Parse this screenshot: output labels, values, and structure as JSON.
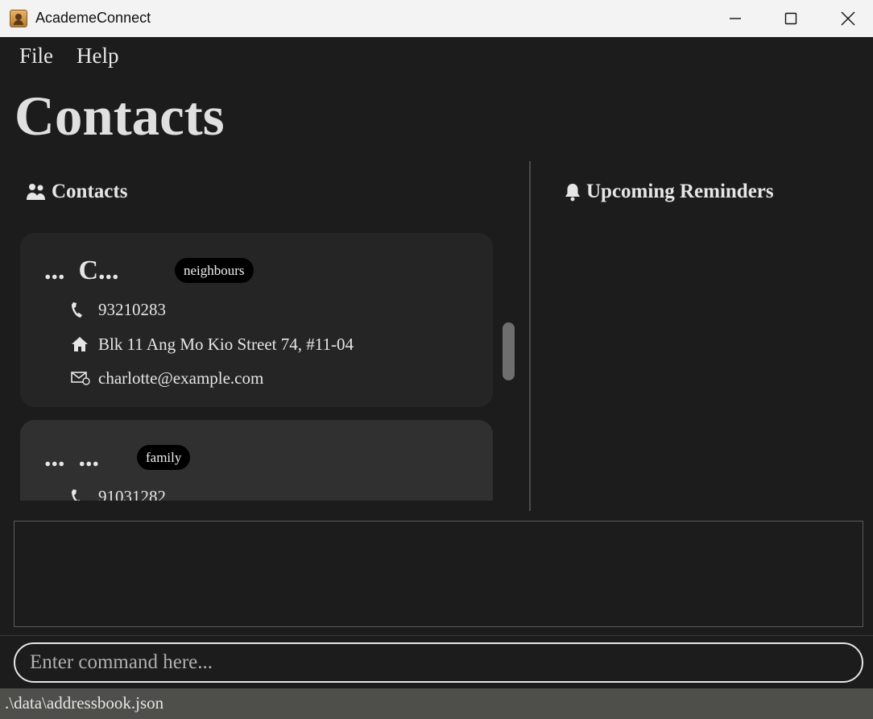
{
  "window": {
    "title": "AcademeConnect"
  },
  "menu": {
    "file": "File",
    "help": "Help"
  },
  "page_title": "Contacts",
  "contacts_panel": {
    "header": "Contacts"
  },
  "reminders_panel": {
    "header": "Upcoming Reminders"
  },
  "contacts": [
    {
      "name": "...  C...",
      "tag": "neighbours",
      "phone": "93210283",
      "address": "Blk 11 Ang Mo Kio Street 74, #11-04",
      "email": "charlotte@example.com"
    },
    {
      "name": "...  ...",
      "tag": "family",
      "phone": "91031282"
    }
  ],
  "command": {
    "placeholder": "Enter command here..."
  },
  "status": {
    "path": ".\\data\\addressbook.json"
  },
  "icons": {
    "app": "address-book-icon",
    "contacts": "people-icon",
    "reminders": "bell-icon",
    "phone": "phone-icon",
    "address": "home-icon",
    "email": "email-icon"
  }
}
